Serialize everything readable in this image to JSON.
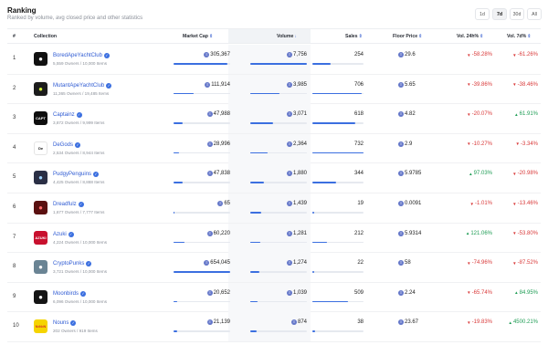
{
  "header": {
    "title": "Ranking",
    "subtitle": "Ranked by volume, avg closed price and other statistics",
    "ranges": [
      "1d",
      "7d",
      "30d",
      "All"
    ],
    "active_range": "7d"
  },
  "columns": {
    "rank": "#",
    "collection": "Collection",
    "market_cap": "Market Cap",
    "volume": "Volume",
    "sales": "Sales",
    "floor_price": "Floor Price",
    "vol24": "Vol. 24h%",
    "vol7": "Vol. 7d%"
  },
  "colors": {
    "accent": "#3b6fe0",
    "up": "#1f9d55",
    "down": "#d93a3a"
  },
  "rows": [
    {
      "rank": "1",
      "name": "BoredApeYachtClub",
      "owners": "5,559 Owners / 10,000 Items",
      "avatar_text": "",
      "avatar_bg": "#111111",
      "avatar_fg": "#ffffff",
      "icon": "ape-skull-icon",
      "market_cap": "305,367",
      "mcap_frac": 0.95,
      "volume": "7,756",
      "vol_frac": 1.0,
      "sales": "254",
      "sales_frac": 0.36,
      "floor": "29.6",
      "ch24": "-58.28%",
      "ch24_dir": "down",
      "ch7": "-61.26%",
      "ch7_dir": "down"
    },
    {
      "rank": "2",
      "name": "MutantApeYachtClub",
      "owners": "11,365 Owners / 19,485 Items",
      "avatar_text": "",
      "avatar_bg": "#1c1c1c",
      "avatar_fg": "#d4f23a",
      "icon": "mutant-ape-icon",
      "market_cap": "111,914",
      "mcap_frac": 0.35,
      "volume": "3,985",
      "vol_frac": 0.51,
      "sales": "706",
      "sales_frac": 0.96,
      "floor": "5.65",
      "ch24": "-39.86%",
      "ch24_dir": "down",
      "ch7": "-38.46%",
      "ch7_dir": "down"
    },
    {
      "rank": "3",
      "name": "Captainz",
      "owners": "3,872 Owners / 9,999 Items",
      "avatar_text": "CAPT",
      "avatar_bg": "#0e0e0e",
      "avatar_fg": "#ffffff",
      "icon": "captainz-logo-icon",
      "market_cap": "47,988",
      "mcap_frac": 0.16,
      "volume": "3,071",
      "vol_frac": 0.4,
      "sales": "618",
      "sales_frac": 0.84,
      "floor": "4.82",
      "ch24": "-20.07%",
      "ch24_dir": "down",
      "ch7": "61.91%",
      "ch7_dir": "up"
    },
    {
      "rank": "4",
      "name": "DeGods",
      "owners": "2,534 Owners / 8,944 Items",
      "avatar_text": "De",
      "avatar_bg": "#ffffff",
      "avatar_fg": "#111111",
      "icon": "degods-logo-icon",
      "market_cap": "28,996",
      "mcap_frac": 0.1,
      "volume": "2,364",
      "vol_frac": 0.3,
      "sales": "732",
      "sales_frac": 1.0,
      "floor": "2.9",
      "ch24": "-10.27%",
      "ch24_dir": "down",
      "ch7": "-3.34%",
      "ch7_dir": "down"
    },
    {
      "rank": "5",
      "name": "PudgyPenguins",
      "owners": "4,425 Owners / 8,888 Items",
      "avatar_text": "",
      "avatar_bg": "#2a2f45",
      "avatar_fg": "#9fd4ff",
      "icon": "penguin-icon",
      "market_cap": "47,838",
      "mcap_frac": 0.16,
      "volume": "1,880",
      "vol_frac": 0.24,
      "sales": "344",
      "sales_frac": 0.47,
      "floor": "5.9785",
      "ch24": "97.03%",
      "ch24_dir": "up",
      "ch7": "-20.98%",
      "ch7_dir": "down"
    },
    {
      "rank": "6",
      "name": "Dreadfulz",
      "owners": "1,677 Owners / 7,777 Items",
      "avatar_text": "",
      "avatar_bg": "#5a1010",
      "avatar_fg": "#ff6b6b",
      "icon": "dreadfulz-icon",
      "market_cap": "65",
      "mcap_frac": 0.0,
      "volume": "1,439",
      "vol_frac": 0.19,
      "sales": "19",
      "sales_frac": 0.03,
      "floor": "0.0091",
      "ch24": "-1.01%",
      "ch24_dir": "down",
      "ch7": "-13.46%",
      "ch7_dir": "down"
    },
    {
      "rank": "7",
      "name": "Azuki",
      "owners": "4,224 Owners / 10,000 Items",
      "avatar_text": "AZUKI",
      "avatar_bg": "#c8102e",
      "avatar_fg": "#ffffff",
      "icon": "azuki-logo-icon",
      "market_cap": "60,220",
      "mcap_frac": 0.2,
      "volume": "1,281",
      "vol_frac": 0.17,
      "sales": "212",
      "sales_frac": 0.29,
      "floor": "5.9314",
      "ch24": "121.06%",
      "ch24_dir": "up",
      "ch7": "-53.80%",
      "ch7_dir": "down"
    },
    {
      "rank": "8",
      "name": "CryptoPunks",
      "owners": "3,721 Owners / 10,000 Items",
      "avatar_text": "",
      "avatar_bg": "#6a8494",
      "avatar_fg": "#ffffff",
      "icon": "punk-icon",
      "market_cap": "654,045",
      "mcap_frac": 1.0,
      "volume": "1,274",
      "vol_frac": 0.16,
      "sales": "22",
      "sales_frac": 0.03,
      "floor": "58",
      "ch24": "-74.96%",
      "ch24_dir": "down",
      "ch7": "-87.52%",
      "ch7_dir": "down"
    },
    {
      "rank": "9",
      "name": "Moonbirds",
      "owners": "6,096 Owners / 10,000 Items",
      "avatar_text": "",
      "avatar_bg": "#141414",
      "avatar_fg": "#ffffff",
      "icon": "moonbird-icon",
      "market_cap": "20,652",
      "mcap_frac": 0.07,
      "volume": "1,039",
      "vol_frac": 0.13,
      "sales": "509",
      "sales_frac": 0.7,
      "floor": "2.24",
      "ch24": "-65.74%",
      "ch24_dir": "down",
      "ch7": "84.95%",
      "ch7_dir": "up"
    },
    {
      "rank": "10",
      "name": "Nouns",
      "owners": "202 Owners / 919 Items",
      "avatar_text": "N•N•N",
      "avatar_bg": "#f5d400",
      "avatar_fg": "#d62828",
      "icon": "nouns-logo-icon",
      "market_cap": "21,139",
      "mcap_frac": 0.07,
      "volume": "874",
      "vol_frac": 0.11,
      "sales": "38",
      "sales_frac": 0.05,
      "floor": "23.67",
      "ch24": "-19.83%",
      "ch24_dir": "down",
      "ch7": "4500.21%",
      "ch7_dir": "up"
    }
  ]
}
